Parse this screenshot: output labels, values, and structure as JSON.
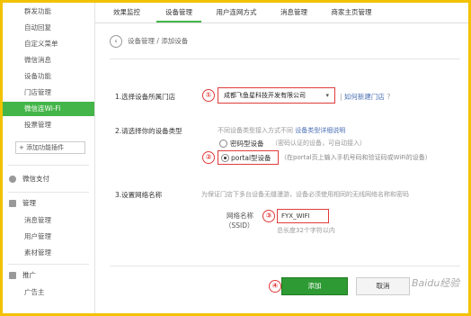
{
  "sidebar": {
    "items": [
      {
        "label": "群发功能"
      },
      {
        "label": "自动回复"
      },
      {
        "label": "自定义菜单"
      },
      {
        "label": "微信消息"
      },
      {
        "label": "设备功能"
      },
      {
        "label": "门店管理"
      },
      {
        "label": "微信连Wi-Fi"
      },
      {
        "label": "投票管理"
      }
    ],
    "add_plugin": "+ 添加功能插件",
    "sections": [
      {
        "label": "微信支付",
        "icon": "wechat-pay-icon"
      },
      {
        "label": "管理",
        "icon": "manage-icon"
      },
      {
        "label": "推广",
        "icon": "promote-icon"
      }
    ],
    "manage_items": [
      {
        "label": "消息管理"
      },
      {
        "label": "用户管理"
      },
      {
        "label": "素材管理"
      }
    ],
    "promote_items": [
      {
        "label": "广告主"
      }
    ]
  },
  "tabs": [
    {
      "label": "效果监控"
    },
    {
      "label": "设备管理"
    },
    {
      "label": "用户连网方式"
    },
    {
      "label": "消息管理"
    },
    {
      "label": "商家主页管理"
    }
  ],
  "breadcrumb": "设备管理 / 添加设备",
  "form": {
    "step1_label": "1.选择设备所属门店",
    "store_value": "成都飞鱼星科技开发有限公司",
    "store_caret": "▾",
    "new_store_link": "如何新建门店",
    "new_store_prefix": "|",
    "new_store_suffix": "?",
    "step2_label": "2.请选择你的设备类型",
    "type_hint": "不同设备类型接入方式不同",
    "type_hint_link": "设备类型详细说明",
    "option1_label": "密码型设备",
    "option1_desc": "（密码认证的设备，可自动接入）",
    "option2_label": "portal型设备",
    "option2_desc": "（在portal页上输入手机号码和验证码或WiFi的设备）",
    "step3_label": "3.设置网络名称",
    "ssid_hint": "为保证门店下多台设备无缝漫游，设备必须使用相同的无线网络名称和密码",
    "ssid_field_label_1": "网络名称",
    "ssid_field_label_2": "（SSID）",
    "ssid_value": "FYX_WIFI",
    "ssid_length_hint": "总长度32个字符以内",
    "add_button": "添加",
    "cancel_button": "取消"
  },
  "markers": [
    "①",
    "②",
    "③",
    "④"
  ],
  "watermark": "Baidu经验",
  "colors": {
    "accent": "#44b549",
    "highlight": "#e23b3b",
    "frame": "#f2c200"
  }
}
